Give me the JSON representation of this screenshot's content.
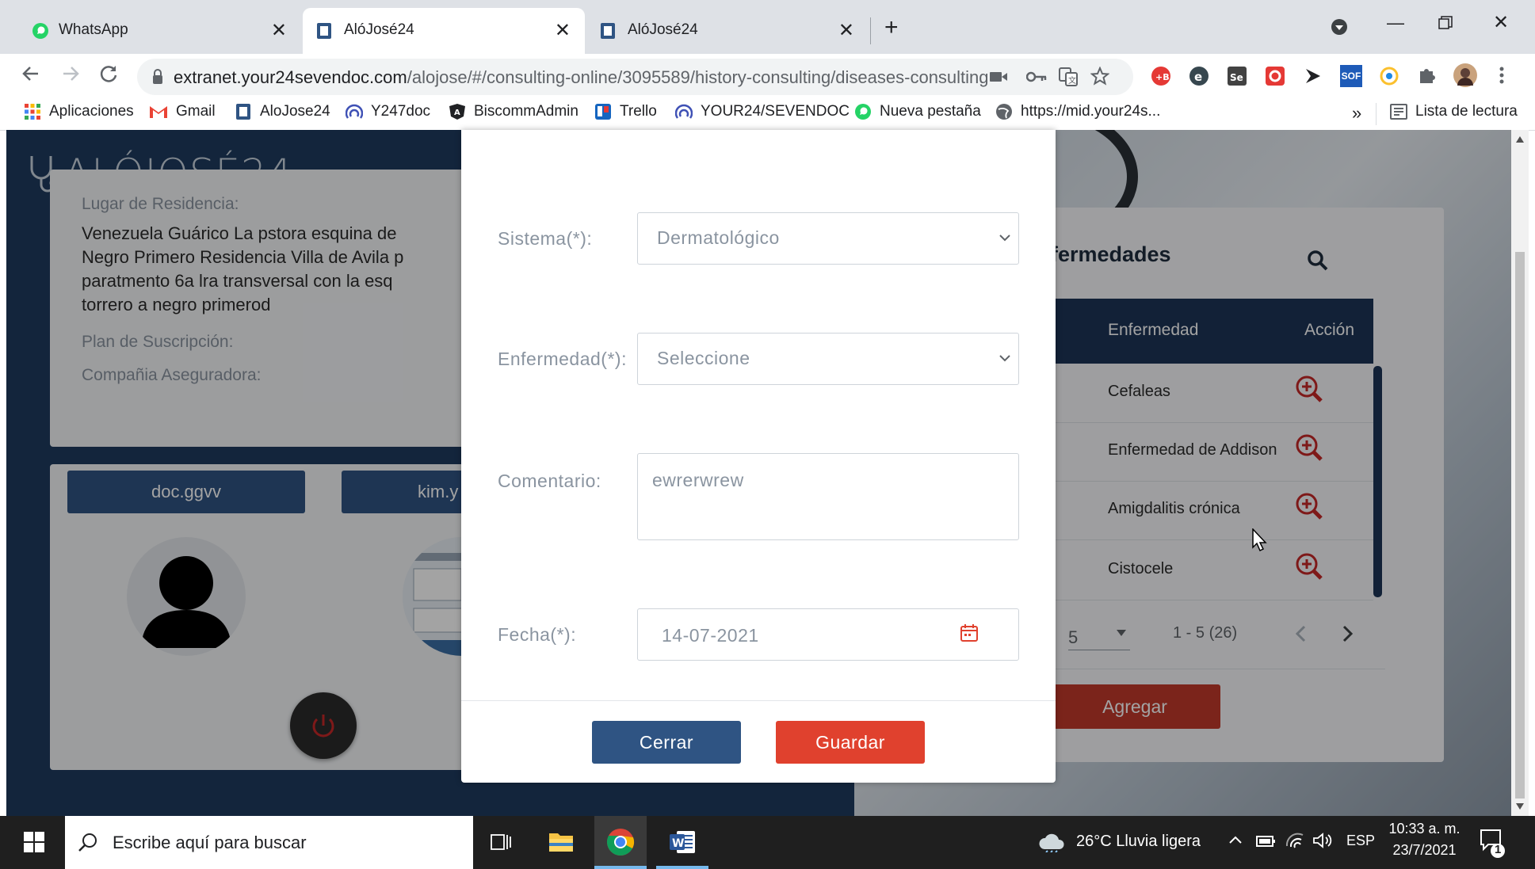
{
  "browser": {
    "tabs": [
      {
        "title": "WhatsApp",
        "active": false
      },
      {
        "title": "AlóJosé24",
        "active": true
      },
      {
        "title": "AlóJosé24",
        "active": false
      }
    ],
    "url_host": "extranet.your24sevendoc.com",
    "url_path": "/alojose/#/consulting-online/3095589/history-consulting/diseases-consulting",
    "extension_label": "SOF",
    "bookmarks": [
      "Aplicaciones",
      "Gmail",
      "AloJose24",
      "Y247doc",
      "BiscommAdmin",
      "Trello",
      "YOUR24/SEVENDOC",
      "Nueva pestaña",
      "https://mid.your24s..."
    ],
    "bookmarks_more": "»",
    "reading_list": "Lista de lectura"
  },
  "app": {
    "logo_text": "ALÓJOSÉ24",
    "patient": {
      "residence_label": "Lugar de Residencia:",
      "residence_lines": [
        "Venezuela Guárico La pstora esquina de",
        "Negro Primero Residencia Villa de Avila p",
        "paratmento 6a lra transversal con la esq",
        "torrero a negro primerod"
      ],
      "plan_label": "Plan de Suscripción:",
      "insurer_label": "Compañia Aseguradora:"
    },
    "participants": [
      {
        "name": "doc.ggvv"
      },
      {
        "name": "kim.y"
      }
    ],
    "diseases_panel": {
      "title": "fermedades",
      "columns": [
        "Enfermedad",
        "Acción"
      ],
      "rows": [
        "Cefaleas",
        "Enfermedad de Addison",
        "Amigdalitis crónica",
        "Cistocele"
      ],
      "page_size_label": ":",
      "page_size": "5",
      "range": "1 - 5 (26)",
      "add_button": "Agregar"
    }
  },
  "modal": {
    "fields": {
      "sistema_label": "Sistema(*):",
      "sistema_value": "Dermatológico",
      "enfermedad_label": "Enfermedad(*):",
      "enfermedad_value": "Seleccione",
      "comentario_label": "Comentario:",
      "comentario_value": "ewrerwrew",
      "fecha_label": "Fecha(*):",
      "fecha_value": "14-07-2021"
    },
    "close_button": "Cerrar",
    "save_button": "Guardar"
  },
  "taskbar": {
    "search_placeholder": "Escribe aquí para buscar",
    "weather": "26°C  Lluvia ligera",
    "language": "ESP",
    "time": "10:33 a. m.",
    "date": "23/7/2021",
    "notification_count": "1"
  },
  "colors": {
    "navy": "#1e3a5f",
    "table_header": "#1d3557",
    "red_button": "#c0392b",
    "save_button": "#e0412e",
    "close_button": "#2f5483",
    "magnify_icon": "#c62828",
    "chrome_tabstrip": "#dee1e6",
    "taskbar": "#1f1f1f"
  }
}
